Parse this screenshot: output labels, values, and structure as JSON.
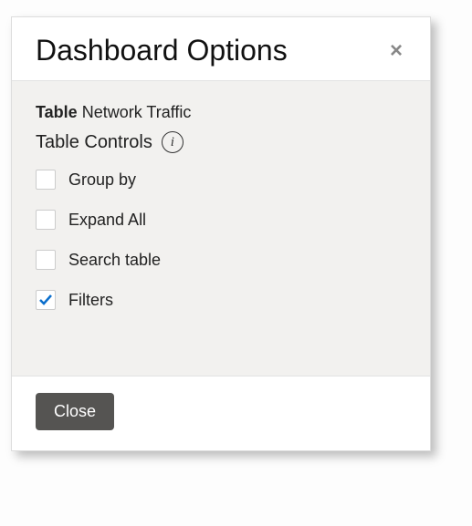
{
  "modal": {
    "title": "Dashboard Options",
    "close_x": "×",
    "table_label": "Table",
    "table_value": "Network Traffic",
    "controls_label": "Table Controls",
    "info_glyph": "i",
    "options": [
      {
        "label": "Group by",
        "checked": false
      },
      {
        "label": "Expand All",
        "checked": false
      },
      {
        "label": "Search table",
        "checked": false
      },
      {
        "label": "Filters",
        "checked": true
      }
    ],
    "close_button": "Close"
  }
}
